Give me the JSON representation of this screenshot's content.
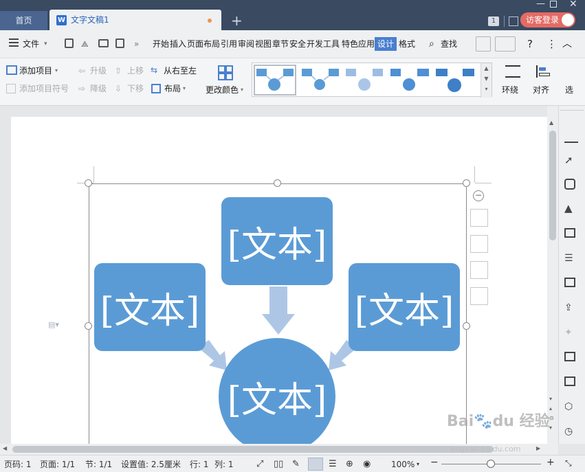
{
  "tabs": {
    "home": "首页",
    "doc": "文字文稿1",
    "new": "+"
  },
  "titlebar": {
    "badge": "1",
    "login": "访客登录"
  },
  "menubar": {
    "file": "文件",
    "items": [
      "开始",
      "插入",
      "页面布局",
      "引用",
      "审阅",
      "视图",
      "章节",
      "安全",
      "开发工具",
      "特色应用",
      "设计",
      "格式"
    ],
    "active": "设计",
    "search": "查找"
  },
  "ribbon": {
    "add_item": "添加项目",
    "add_bullet": "添加项目符号",
    "promote": "升级",
    "demote": "降级",
    "move_up": "上移",
    "move_down": "下移",
    "rtl": "从右至左",
    "layout": "布局",
    "change_color": "更改颜色",
    "wrap": "环绕",
    "align": "对齐",
    "select": "选"
  },
  "smartart": {
    "nodes": [
      "[文本]",
      "[文本]",
      "[文本]",
      "[文本]"
    ]
  },
  "status": {
    "page_no": "页码: 1",
    "pages": "页面: 1/1",
    "section": "节: 1/1",
    "setting": "设置值: 2.5厘米",
    "row": "行: 1",
    "col": "列: 1",
    "zoom": "100%"
  },
  "watermark": "Bai du 经验 jingyan.baidu.com",
  "colors": {
    "accent": "#5b9bd5",
    "arrow": "#aec6e6",
    "tabbar": "#394a61",
    "active_tab": "#4a7fd0"
  }
}
